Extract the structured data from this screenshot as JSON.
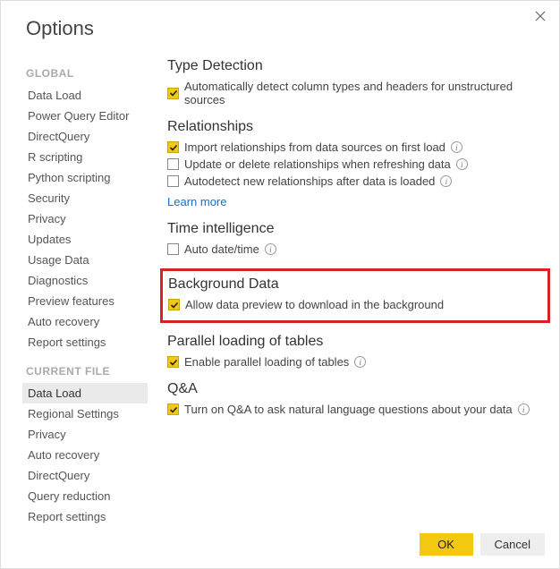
{
  "title": "Options",
  "close_label": "Close",
  "sidebar": {
    "global_header": "GLOBAL",
    "global_items": [
      "Data Load",
      "Power Query Editor",
      "DirectQuery",
      "R scripting",
      "Python scripting",
      "Security",
      "Privacy",
      "Updates",
      "Usage Data",
      "Diagnostics",
      "Preview features",
      "Auto recovery",
      "Report settings"
    ],
    "current_header": "CURRENT FILE",
    "current_items": [
      "Data Load",
      "Regional Settings",
      "Privacy",
      "Auto recovery",
      "DirectQuery",
      "Query reduction",
      "Report settings"
    ],
    "current_selected_index": 0
  },
  "sections": {
    "type_detection": {
      "title": "Type Detection",
      "opt1": {
        "label": "Automatically detect column types and headers for unstructured sources",
        "checked": true
      }
    },
    "relationships": {
      "title": "Relationships",
      "opt1": {
        "label": "Import relationships from data sources on first load",
        "checked": true,
        "info": true
      },
      "opt2": {
        "label": "Update or delete relationships when refreshing data",
        "checked": false,
        "info": true
      },
      "opt3": {
        "label": "Autodetect new relationships after data is loaded",
        "checked": false,
        "info": true
      },
      "learn_more": "Learn more"
    },
    "time_intelligence": {
      "title": "Time intelligence",
      "opt1": {
        "label": "Auto date/time",
        "checked": false,
        "info": true
      }
    },
    "background_data": {
      "title": "Background Data",
      "opt1": {
        "label": "Allow data preview to download in the background",
        "checked": true
      }
    },
    "parallel": {
      "title": "Parallel loading of tables",
      "opt1": {
        "label": "Enable parallel loading of tables",
        "checked": true,
        "info": true
      }
    },
    "qa": {
      "title": "Q&A",
      "opt1": {
        "label": "Turn on Q&A to ask natural language questions about your data",
        "checked": true,
        "info": true
      }
    }
  },
  "buttons": {
    "ok": "OK",
    "cancel": "Cancel"
  }
}
